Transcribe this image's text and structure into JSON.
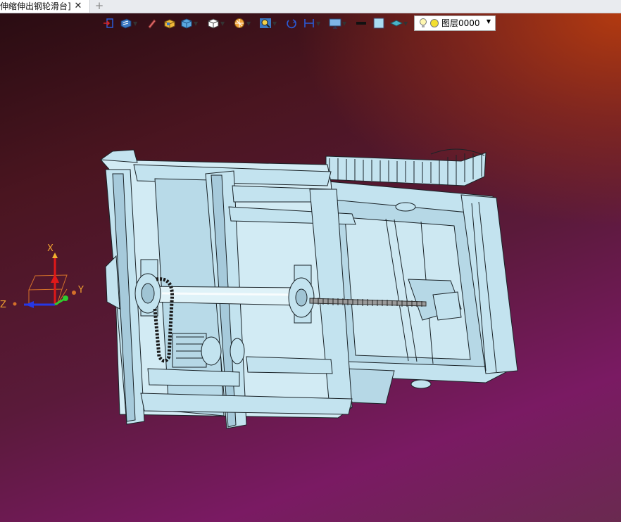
{
  "tab": {
    "title": "伸缩伸出钢轮滑台]",
    "close": "✕",
    "new_tab": "+"
  },
  "layer": {
    "value": "图层0000"
  },
  "axes": {
    "x": "X",
    "y": "Y",
    "z": "Z"
  },
  "colors": {
    "part_fill": "#c3e3ef",
    "part_stroke": "#1a2328",
    "x_axis": "#e01818",
    "y_axis": "#2ecc2e",
    "z_axis": "#2638e6"
  },
  "toolbar_icons": [
    "exit-icon",
    "view-icon",
    "pen-icon",
    "box-icon",
    "solid-icon",
    "cube-icon",
    "render-icon",
    "zoom-icon",
    "rotate-icon",
    "measure-icon",
    "display-icon",
    "line-icon",
    "color-icon",
    "layer-style-icon"
  ]
}
